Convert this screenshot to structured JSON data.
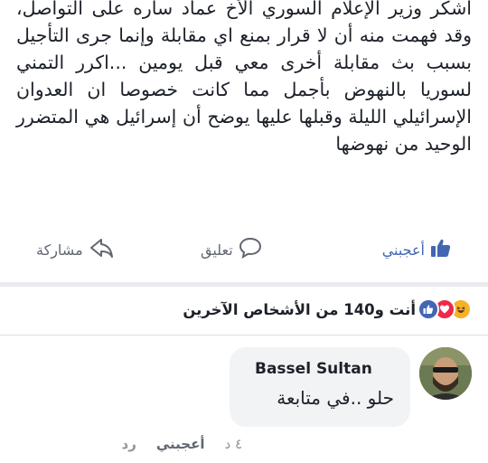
{
  "post": {
    "text": "اشكر وزير الإعلام السوري الأخ عماد ساره على التواصل، وقد فهمت منه أن لا قرار بمنع اي مقابلة وإنما جرى التأجيل بسبب بث مقابلة أخرى معي قبل يومين ...اكرر التمني لسوريا بالنهوض بأجمل مما كانت خصوصا ان العدوان الإسرائيلي الليلة وقبلها عليها يوضح أن إسرائيل هي المتضرر الوحيد من نهوضها"
  },
  "actions": {
    "like": "أعجبني",
    "comment": "تعليق",
    "share": "مشاركة"
  },
  "reactions": {
    "summary": "أنت و140 من الأشخاص الآخرين",
    "types": [
      "like-icon",
      "love-icon",
      "haha-icon"
    ],
    "colors": {
      "like": "#4267b2",
      "love": "#f0284a",
      "haha": "#f7b125"
    }
  },
  "comment": {
    "author": "Bassel Sultan",
    "text": "حلو ..في متابعة",
    "time": "٤ د",
    "like_label": "أعجبني",
    "reply_label": "رد"
  },
  "theme": {
    "accent": "#4267b2",
    "muted": "#606770"
  }
}
